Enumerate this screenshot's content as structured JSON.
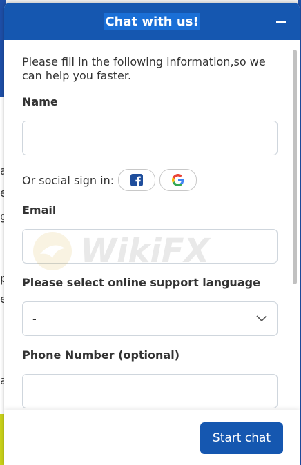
{
  "widget": {
    "title": "Chat with us!",
    "intro": "Please fill in the following information,so we can help you faster.",
    "name_label": "Name",
    "name_value": "",
    "social_label": "Or social sign in:",
    "email_label": "Email",
    "email_value": "",
    "language_label": "Please select online support language",
    "language_value": "-",
    "phone_label": "Phone Number (optional)",
    "phone_value": "",
    "start_button": "Start chat"
  },
  "watermark": {
    "text": "WikiFX"
  },
  "background": {
    "fragments": [
      "a",
      "e",
      "g",
      "p",
      "e",
      "a"
    ]
  },
  "colors": {
    "header": "#1557b0",
    "button": "#1557b0",
    "facebook": "#1877f2"
  },
  "icons": [
    "minimize-icon",
    "facebook-icon",
    "google-icon",
    "chevron-down-icon"
  ]
}
